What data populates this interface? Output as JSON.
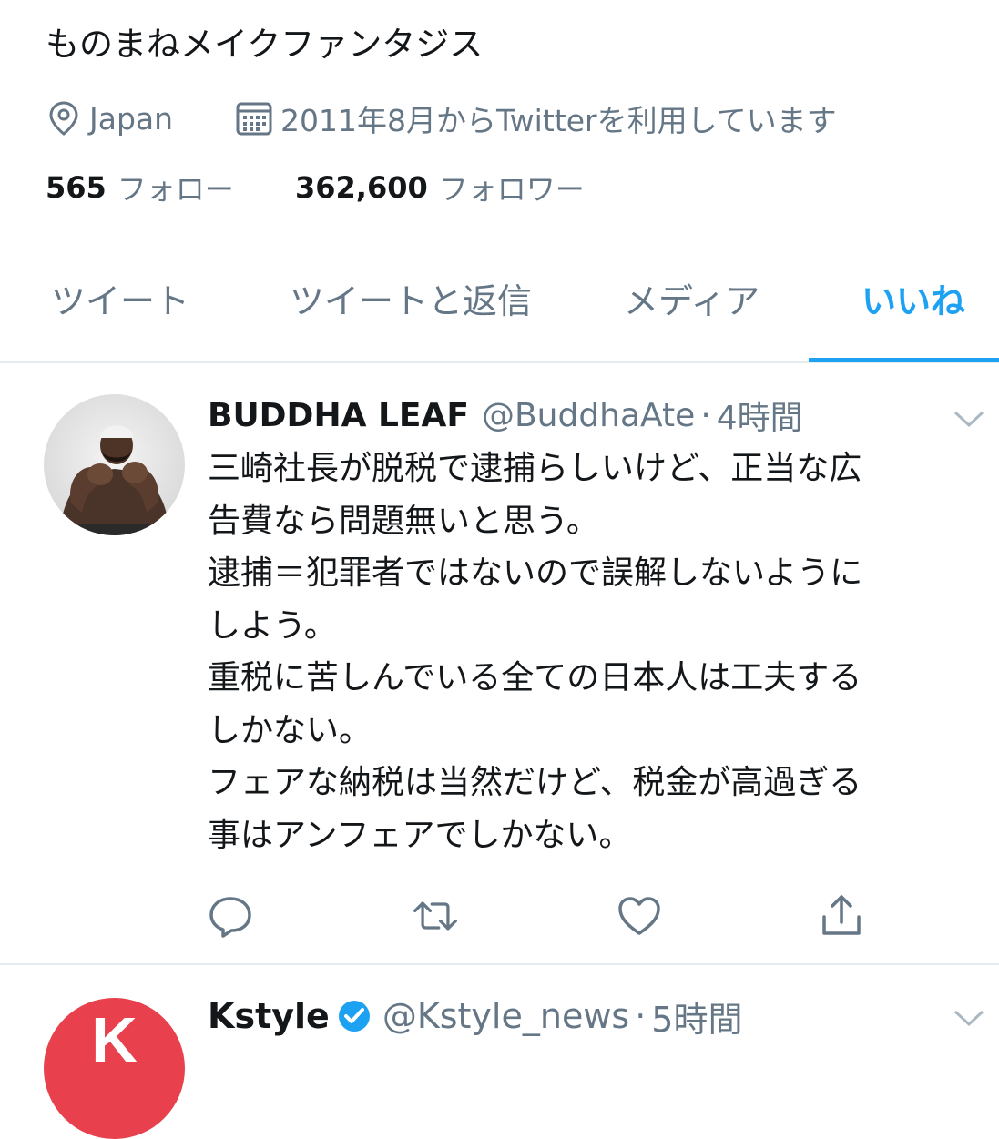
{
  "profile": {
    "bio": "ものまねメイクファンタジス",
    "location": "Japan",
    "joined": "2011年8月からTwitterを利用しています",
    "following_count": "565",
    "following_label": "フォロー",
    "followers_count": "362,600",
    "followers_label": "フォロワー"
  },
  "tabs": [
    {
      "label": "ツイート",
      "active": false
    },
    {
      "label": "ツイートと返信",
      "active": false
    },
    {
      "label": "メディア",
      "active": false
    },
    {
      "label": "いいね",
      "active": true
    }
  ],
  "tweets": [
    {
      "name": "BUDDHA LEAF",
      "handle": "@BuddhaAte",
      "separator": "·",
      "time": "4時間",
      "lines": [
        "三崎社長が脱税で逮捕らしいけど、正当な広",
        "告費なら問題無いと思う。",
        "逮捕＝犯罪者ではないので誤解しないように",
        "しよう。",
        "重税に苦しんでいる全ての日本人は工夫する",
        "しかない。",
        "フェアな納税は当然だけど、税金が高過ぎる",
        "事はアンフェアでしかない。"
      ]
    },
    {
      "name": "Kstyle",
      "handle": "@Kstyle_news",
      "separator": "·",
      "time": "5時間",
      "verified": true,
      "avatar_letter": "K"
    }
  ],
  "colors": {
    "accent": "#1da1f2",
    "secondary_text": "#657786",
    "primary_text": "#14171a",
    "divider": "#e6ecf0",
    "kstyle_brand": "#e8414d"
  },
  "icons": [
    "location-icon",
    "calendar-icon",
    "reply-icon",
    "retweet-icon",
    "like-icon",
    "share-icon",
    "chevron-down-icon",
    "verified-badge-icon"
  ]
}
